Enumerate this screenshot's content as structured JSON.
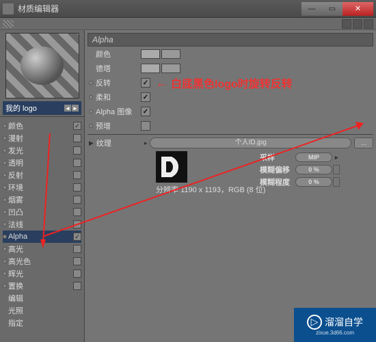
{
  "window": {
    "title": "材质编辑器"
  },
  "material": {
    "name": "我的 logo"
  },
  "channels": [
    {
      "label": "颜色",
      "checked": true
    },
    {
      "label": "漫射",
      "checked": false
    },
    {
      "label": "发光",
      "checked": false
    },
    {
      "label": "透明",
      "checked": false
    },
    {
      "label": "反射",
      "checked": false
    },
    {
      "label": "环境",
      "checked": false
    },
    {
      "label": "烟雾",
      "checked": false
    },
    {
      "label": "凹凸",
      "checked": false
    },
    {
      "label": "法线",
      "checked": false
    },
    {
      "label": "Alpha",
      "checked": true,
      "selected": true
    },
    {
      "label": "高光",
      "checked": false
    },
    {
      "label": "高光色",
      "checked": false
    },
    {
      "label": "辉光",
      "checked": false
    },
    {
      "label": "置换",
      "checked": false
    },
    {
      "label": "编辑"
    },
    {
      "label": "光照"
    },
    {
      "label": "指定"
    }
  ],
  "alpha": {
    "title": "Alpha",
    "rows": {
      "color": "颜色",
      "delta": "德塔",
      "invert": "反转",
      "soft": "柔和",
      "alphaimg": "Alpha 图像",
      "premult": "预增"
    },
    "invert_checked": true,
    "soft_checked": true,
    "alphaimg_checked": true,
    "premult_checked": false,
    "annotation": "白底黑色logo时旋转反转",
    "texture": {
      "label": "纹理",
      "file": "个人ID.jpg",
      "sample": "采样",
      "sample_val": "MIP",
      "blur_off": "模糊偏移",
      "blur_off_val": "0 %",
      "blur_scale": "模糊程度",
      "blur_scale_val": "0 %",
      "resolution": "分辨率 1190 x 1193，RGB (8 位)"
    }
  },
  "watermark": {
    "main": "溜溜自学",
    "sub": "zixue.3d66.com"
  }
}
